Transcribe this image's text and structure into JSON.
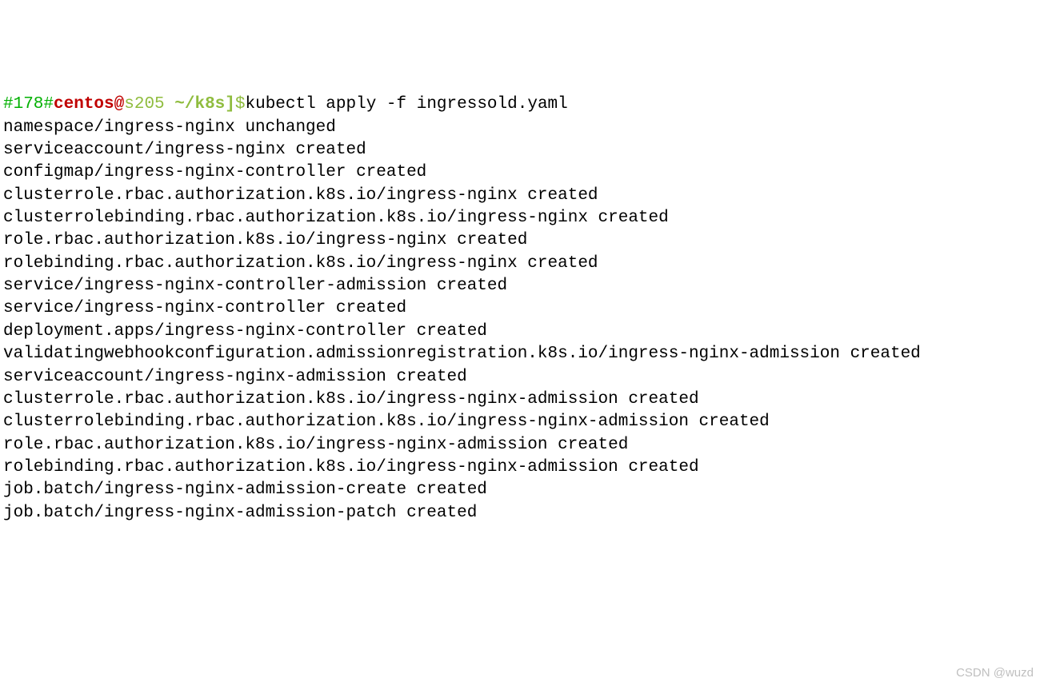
{
  "prompt": {
    "counter": "#178#",
    "user": "centos@",
    "host": "s205",
    "path": " ~/k8s]",
    "dollar": "$"
  },
  "command": "kubectl apply -f ingressold.yaml",
  "output": [
    "namespace/ingress-nginx unchanged",
    "serviceaccount/ingress-nginx created",
    "configmap/ingress-nginx-controller created",
    "clusterrole.rbac.authorization.k8s.io/ingress-nginx created",
    "clusterrolebinding.rbac.authorization.k8s.io/ingress-nginx created",
    "role.rbac.authorization.k8s.io/ingress-nginx created",
    "rolebinding.rbac.authorization.k8s.io/ingress-nginx created",
    "service/ingress-nginx-controller-admission created",
    "service/ingress-nginx-controller created",
    "deployment.apps/ingress-nginx-controller created",
    "validatingwebhookconfiguration.admissionregistration.k8s.io/ingress-nginx-admission created",
    "serviceaccount/ingress-nginx-admission created",
    "clusterrole.rbac.authorization.k8s.io/ingress-nginx-admission created",
    "clusterrolebinding.rbac.authorization.k8s.io/ingress-nginx-admission created",
    "role.rbac.authorization.k8s.io/ingress-nginx-admission created",
    "rolebinding.rbac.authorization.k8s.io/ingress-nginx-admission created",
    "job.batch/ingress-nginx-admission-create created",
    "job.batch/ingress-nginx-admission-patch created"
  ],
  "watermark": "CSDN @wuzd"
}
